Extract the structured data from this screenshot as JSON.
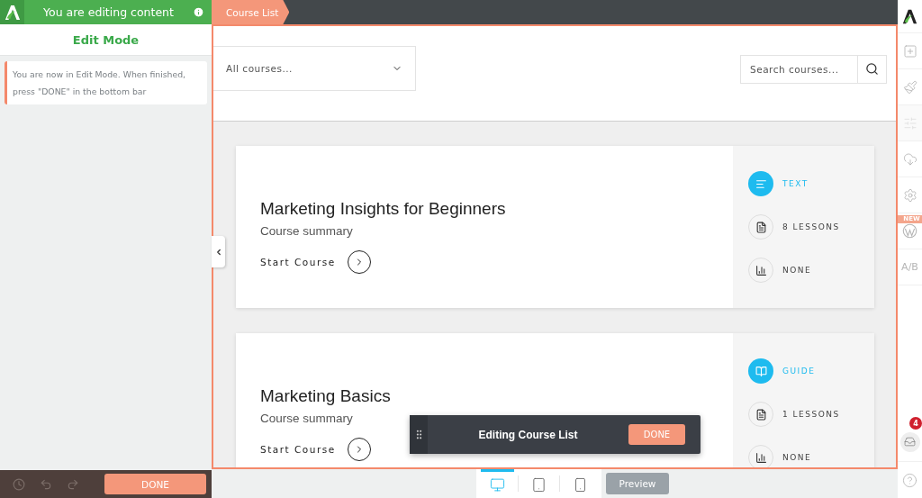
{
  "sidebar": {
    "header_title": "You are editing content",
    "mode_title": "Edit Mode",
    "notice": "You are now in Edit Mode. When finished, press \"DONE\" in the bottom bar",
    "done_button": "DONE"
  },
  "breadcrumb": "Course List",
  "filters": {
    "select_value": "All courses...",
    "search_placeholder": "Search courses..."
  },
  "courses": [
    {
      "title": "Marketing Insights for Beginners",
      "summary": "Course summary",
      "cta": "Start Course",
      "meta": [
        {
          "kind": "text",
          "label": "TEXT"
        },
        {
          "kind": "lessons",
          "label": "8 LESSONS"
        },
        {
          "kind": "level",
          "label": "NONE"
        }
      ]
    },
    {
      "title": "Marketing Basics",
      "summary": "Course summary",
      "cta": "Start Course",
      "meta": [
        {
          "kind": "guide",
          "label": "GUIDE"
        },
        {
          "kind": "lessons",
          "label": "1 LESSONS"
        },
        {
          "kind": "level",
          "label": "NONE"
        }
      ]
    }
  ],
  "floating_toolbar": {
    "title": "Editing Course List",
    "done_button": "DONE"
  },
  "devices": [
    {
      "kind": "desktop",
      "selected": true
    },
    {
      "kind": "tablet",
      "selected": false
    },
    {
      "kind": "phone",
      "selected": false
    }
  ],
  "preview_button": {
    "label": "Preview",
    "disabled": true
  },
  "right_rail": [
    {
      "kind": "add"
    },
    {
      "kind": "brush"
    },
    {
      "kind": "sliders"
    },
    {
      "kind": "cloud"
    },
    {
      "kind": "settings"
    },
    {
      "kind": "wordpress",
      "badge": "NEW"
    },
    {
      "kind": "ab",
      "label": "A/B"
    }
  ],
  "right_rail_bottom": [
    {
      "kind": "inbox",
      "badge": "4"
    },
    {
      "kind": "help"
    }
  ]
}
